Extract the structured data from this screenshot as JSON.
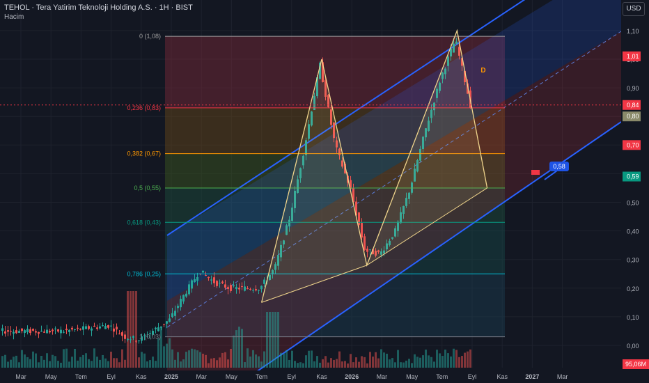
{
  "header": {
    "title": "TEHOL · Tera Yatirim Teknoloji Holding A.S. · 1H · BIST",
    "volume_label": "Hacim",
    "currency_button": "USD"
  },
  "colors": {
    "background": "#131722",
    "up": "#26a69a",
    "down": "#ef5350",
    "channel": "#2962ff",
    "pattern": "#f0d58c",
    "axis_text": "#b2b5be"
  },
  "price_axis": {
    "ticks": [
      "1,10",
      "1,00",
      "0,90",
      "0,80",
      "0,70",
      "0,60",
      "0,50",
      "0,40",
      "0,30",
      "0,20",
      "0,10",
      "0,00"
    ],
    "tick_values": [
      1.1,
      1.0,
      0.9,
      0.8,
      0.7,
      0.6,
      0.5,
      0.4,
      0.3,
      0.2,
      0.1,
      0.0
    ],
    "badges": [
      {
        "label": "1,01",
        "value": 1.01,
        "color": "#f23645"
      },
      {
        "label": "0,84",
        "value": 0.84,
        "color": "#f23645"
      },
      {
        "label": "0,80",
        "value": 0.8,
        "color": "#8a8a6a"
      },
      {
        "label": "0,70",
        "value": 0.7,
        "color": "#f23645"
      },
      {
        "label": "0,59",
        "value": 0.59,
        "color": "#089981"
      }
    ],
    "volume_badge": {
      "label": "95,06M",
      "color": "#f23645"
    }
  },
  "time_axis": {
    "labels": [
      "Mar",
      "May",
      "Tem",
      "Eyl",
      "Kas",
      "2025",
      "Mar",
      "May",
      "Tem",
      "Eyl",
      "Kas",
      "2026",
      "Mar",
      "May",
      "Tem",
      "Eyl",
      "Kas",
      "2027",
      "Mar"
    ],
    "bold": [
      "2025",
      "2026",
      "2027"
    ]
  },
  "fibonacci": {
    "levels": [
      {
        "label": "0 (1,08)",
        "ratio": 0,
        "price": 1.08,
        "color": "#9e9e9e"
      },
      {
        "label": "0,236 (0,83)",
        "ratio": 0.236,
        "price": 0.83,
        "color": "#f23645"
      },
      {
        "label": "0,382 (0,67)",
        "ratio": 0.382,
        "price": 0.67,
        "color": "#ff9800"
      },
      {
        "label": "0,5 (0,55)",
        "ratio": 0.5,
        "price": 0.55,
        "color": "#4caf50"
      },
      {
        "label": "0,618 (0,43)",
        "ratio": 0.618,
        "price": 0.43,
        "color": "#089981"
      },
      {
        "label": "0,786 (0,25)",
        "ratio": 0.786,
        "price": 0.25,
        "color": "#00bcd4"
      },
      {
        "label": "1 (0,03)",
        "ratio": 1,
        "price": 0.03,
        "color": "#787b86"
      }
    ]
  },
  "annotations": {
    "pattern_point_label": "D",
    "target_label": "0,58"
  },
  "chart_data": {
    "type": "candlestick",
    "title": "TEHOL · Tera Yatirim Teknoloji Holding A.S. · 1H · BIST",
    "y_axis_currency": "USD",
    "ylim": [
      -0.07,
      1.15
    ],
    "x_start": "2024-02",
    "x_end": "2027-04",
    "grid": true,
    "price_path": [
      [
        "2024-02",
        0.05
      ],
      [
        "2024-06",
        0.05
      ],
      [
        "2024-09",
        0.07
      ],
      [
        "2024-10",
        0.03
      ],
      [
        "2024-11",
        0.02
      ],
      [
        "2025-01",
        0.09
      ],
      [
        "2025-02",
        0.18
      ],
      [
        "2025-03",
        0.26
      ],
      [
        "2025-04",
        0.22
      ],
      [
        "2025-05",
        0.2
      ],
      [
        "2025-07",
        0.2
      ],
      [
        "2025-08",
        0.27
      ],
      [
        "2025-09",
        0.45
      ],
      [
        "2025-10",
        0.7
      ],
      [
        "2025-11",
        0.98
      ],
      [
        "2025-12",
        0.7
      ],
      [
        "2026-01",
        0.55
      ],
      [
        "2026-02",
        0.33
      ],
      [
        "2026-03",
        0.32
      ],
      [
        "2026-04",
        0.4
      ],
      [
        "2026-05",
        0.55
      ],
      [
        "2026-06",
        0.75
      ],
      [
        "2026-07",
        0.93
      ],
      [
        "2026-08",
        1.07
      ],
      [
        "2026-09",
        0.84
      ]
    ],
    "volume_peak": "95,06M",
    "series": [
      {
        "name": "Hacim",
        "type": "volume"
      }
    ],
    "pattern_xabcd": [
      [
        "2025-07",
        0.15
      ],
      [
        "2025-11",
        1.0
      ],
      [
        "2026-02",
        0.28
      ],
      [
        "2026-08",
        1.1
      ],
      [
        "2026-10",
        0.55
      ]
    ],
    "last_price": 0.84
  }
}
